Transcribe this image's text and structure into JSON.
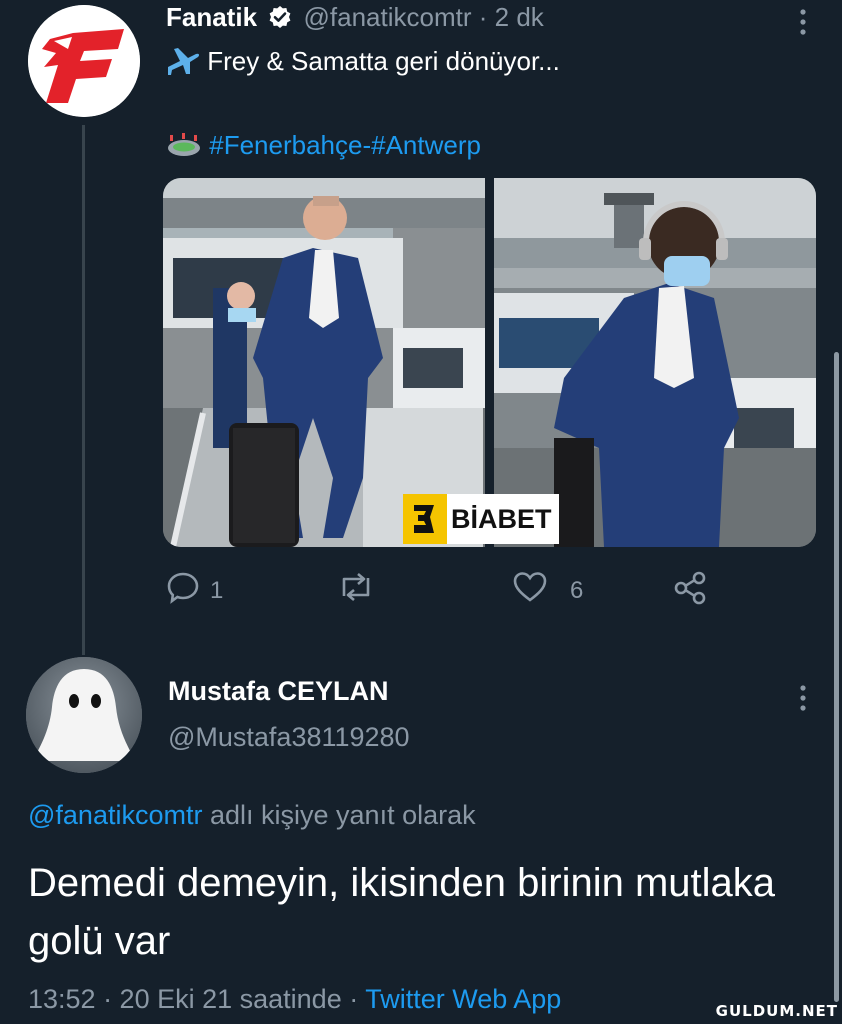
{
  "original_tweet": {
    "display_name": "Fanatik",
    "handle": "@fanatikcomtr",
    "separator": "·",
    "time_ago": "2 dk",
    "line1_emoji": "✈️",
    "line1_text": "Frey & Samatta geri dönüyor...",
    "line2_emoji": "🏟️",
    "hashtag_text": "#Fenerbahçe-#Antwerp",
    "media_overlay_logo": "BİABET",
    "actions": {
      "reply_count": "1",
      "retweet_count": "",
      "like_count": "6"
    }
  },
  "reply": {
    "display_name": "Mustafa CEYLAN",
    "handle": "@Mustafa38119280",
    "replying_to_handle": "@fanatikcomtr",
    "replying_to_suffix": "adlı kişiye yanıt olarak",
    "text": "Demedi demeyin, ikisinden birinin mutlaka golü var",
    "timestamp": "13:52 · 20 Eki 21 saatinde ·",
    "source": "Twitter Web App"
  },
  "watermark": "GULDUM.NET",
  "icons": {
    "verified": "verified-badge-icon",
    "more": "more-options-icon",
    "reply": "reply-icon",
    "retweet": "retweet-icon",
    "like": "like-icon",
    "share": "share-icon"
  },
  "colors": {
    "background": "#15202b",
    "text": "#ffffff",
    "muted": "#8b98a5",
    "link": "#1d9bf0",
    "brand_red": "#e3222a"
  }
}
